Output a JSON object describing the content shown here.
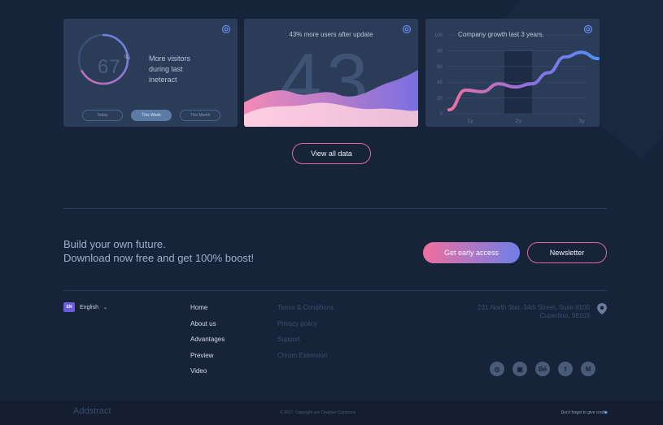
{
  "cards": {
    "visitors": {
      "value": "67",
      "unit": "%",
      "progress": 0.67,
      "text": "More visitors during last ineteract",
      "segments": [
        "Today",
        "This Week",
        "This Month"
      ],
      "active_segment": "This Week",
      "icon": "gear-icon"
    },
    "users": {
      "title": "43% more users after update",
      "value": "43",
      "icon": "gear-icon"
    },
    "growth": {
      "title": "Company growth last 3 years.",
      "icon": "gear-icon"
    }
  },
  "chart_data": {
    "type": "line",
    "title": "Company growth last 3 years.",
    "x": [
      "1y",
      "2y",
      "3y"
    ],
    "y_ticks": [
      "100",
      "80",
      "60",
      "40",
      "20",
      "0"
    ],
    "ylim": [
      0,
      100
    ],
    "series": [
      {
        "values": [
          5,
          30,
          28,
          38,
          34,
          38,
          52,
          72,
          78,
          70
        ]
      }
    ],
    "colors": [
      "#ef6fa0",
      "#8f6fe0",
      "#4f8ff8"
    ]
  },
  "view_all": "View all data",
  "cta": {
    "line1": "Build your own future.",
    "line2": "Download now free and get 100% boost!",
    "primary": "Get early access",
    "secondary": "Newsletter"
  },
  "language": {
    "code": "EN",
    "label": "English"
  },
  "nav_primary": [
    "Home",
    "About us",
    "Advantages",
    "Preview",
    "Video"
  ],
  "nav_secondary": [
    "Terms & Conditions",
    "Privacy policy",
    "Support",
    "Chrom Extension"
  ],
  "address": {
    "line1": "231 North Star. 34th Street, Suite #100",
    "line2": "Cupertino, 98103"
  },
  "socials": [
    "dribbble-icon",
    "instagram-icon",
    "behance-icon",
    "facebook-icon",
    "medium-icon"
  ],
  "footer": {
    "brand": "Addstract",
    "copyright": "© 2017. Copyright are Creative Commons",
    "credit": "Don't forget to give credit"
  }
}
